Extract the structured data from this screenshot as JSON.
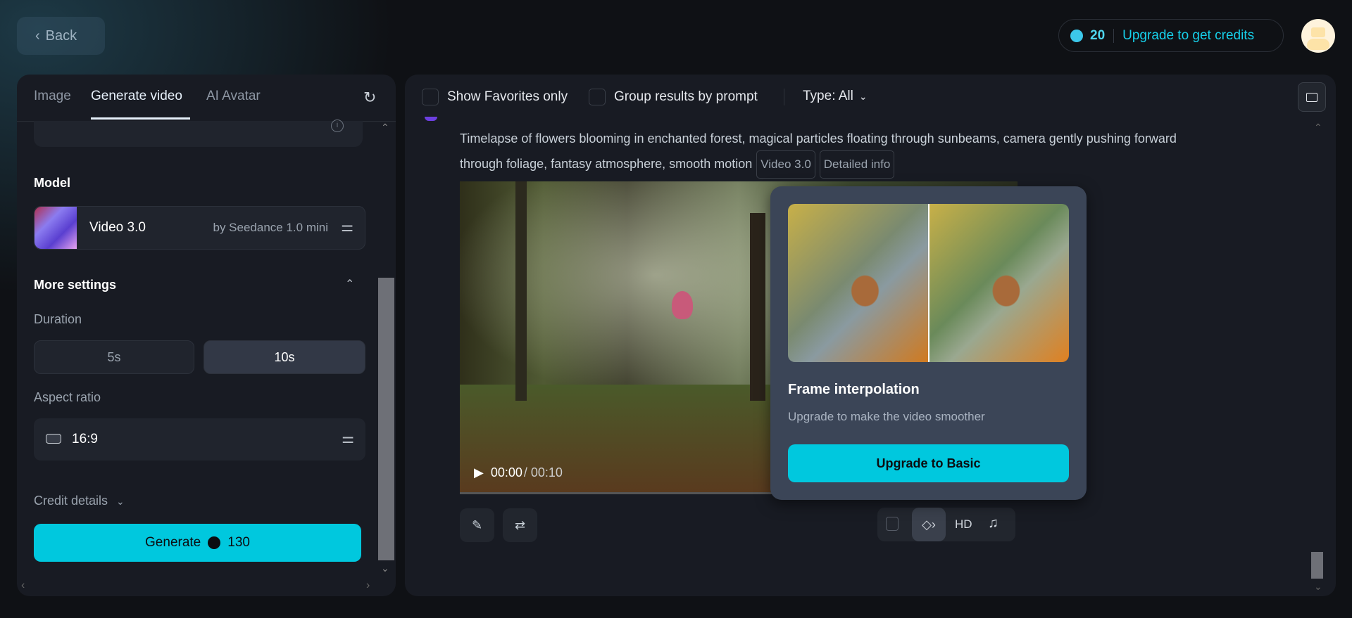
{
  "header": {
    "back_label": "Back",
    "credits": "20",
    "upgrade_label": "Upgrade to get credits"
  },
  "left": {
    "tabs": [
      {
        "label": "Image"
      },
      {
        "label": "Generate video"
      },
      {
        "label": "AI Avatar"
      }
    ],
    "model_heading": "Model",
    "model": {
      "name": "Video 3.0",
      "provider": "by Seedance 1.0 mini"
    },
    "more_settings": "More settings",
    "duration_label": "Duration",
    "durations": [
      {
        "label": "5s"
      },
      {
        "label": "10s"
      }
    ],
    "selected_duration": "10s",
    "aspect_label": "Aspect ratio",
    "aspect_value": "16:9",
    "credit_details": "Credit details",
    "generate_label": "Generate",
    "generate_cost": "130"
  },
  "right": {
    "show_favorites": "Show Favorites only",
    "group_by_prompt": "Group results by prompt",
    "type_filter": "Type: All",
    "prompt_line1": "Timelapse of flowers blooming in enchanted forest, magical particles floating through sunbeams, camera gently pushing forward",
    "prompt_line2": "through foliage, fantasy atmosphere, smooth motion",
    "tags": [
      "Video 3.0",
      "Detailed info"
    ],
    "video_time": "00:00",
    "video_duration": "/ 00:10",
    "toolbar_hd": "HD"
  },
  "popup": {
    "title": "Frame interpolation",
    "subtitle": "Upgrade to make the video smoother",
    "button": "Upgrade to Basic"
  },
  "colors": {
    "accent": "#00c8de",
    "bg": "#0f1115",
    "panel": "#181b23",
    "popup": "#3b4557"
  }
}
